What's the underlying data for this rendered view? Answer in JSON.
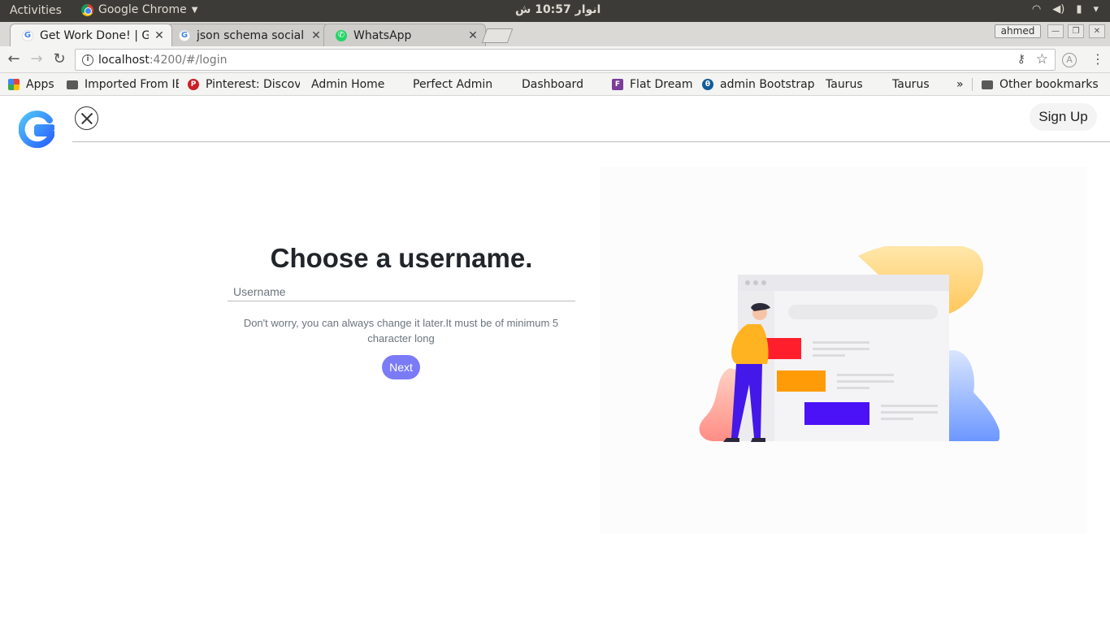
{
  "os": {
    "activities": "Activities",
    "app_name": "Google Chrome",
    "clock": "انوار 10:57 ش",
    "user": "ahmed"
  },
  "tabs": [
    {
      "title": "Get Work Done! | Gaaan",
      "icon": "google-icon",
      "active": true
    },
    {
      "title": "json schema social",
      "icon": "google-icon",
      "active": false
    },
    {
      "title": "WhatsApp",
      "icon": "whatsapp-icon",
      "active": false
    }
  ],
  "address": {
    "host": "localhost",
    "path": ":4200/#/login"
  },
  "bookmarks": [
    {
      "label": "Apps",
      "icon": "apps-icon"
    },
    {
      "label": "Imported From IE",
      "icon": "folder-icon"
    },
    {
      "label": "Pinterest: Discover",
      "icon": "pinterest-icon"
    },
    {
      "label": "Admin Home",
      "icon": "page-icon"
    },
    {
      "label": "Perfect Admin",
      "icon": "page-icon"
    },
    {
      "label": "Dashboard",
      "icon": "page-icon"
    },
    {
      "label": "Flat Dream",
      "icon": "flatdream-icon"
    },
    {
      "label": "admin Bootstrap",
      "icon": "bootstrap-icon"
    },
    {
      "label": "Taurus",
      "icon": "page-icon"
    },
    {
      "label": "Taurus",
      "icon": "page-icon"
    },
    {
      "label": "»",
      "icon": ""
    },
    {
      "label": "Other bookmarks",
      "icon": "folder-icon"
    }
  ],
  "page": {
    "signup_label": "Sign Up",
    "heading": "Choose a username.",
    "username_placeholder": "Username",
    "hint": "Don't worry, you can always change it later.It must be of minimum 5 character long",
    "next_label": "Next",
    "accent_color": "#7b7bf7"
  }
}
